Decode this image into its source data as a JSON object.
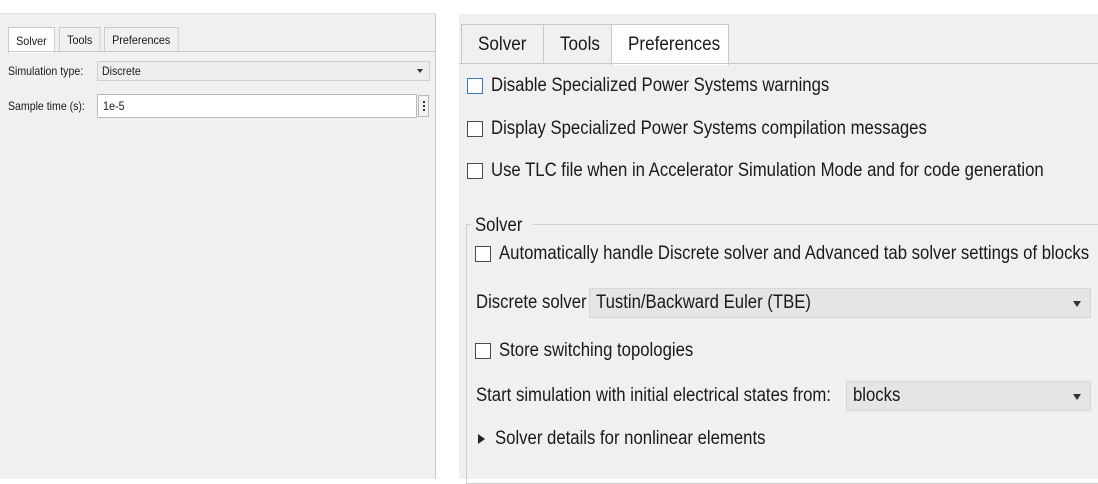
{
  "left_panel": {
    "tabs": [
      "Solver",
      "Tools",
      "Preferences"
    ],
    "active_tab": "Solver",
    "simulation_type": {
      "label": "Simulation type:",
      "value": "Discrete"
    },
    "sample_time": {
      "label": "Sample time (s):",
      "value": "1e-5"
    }
  },
  "right_panel": {
    "tabs": [
      "Solver",
      "Tools",
      "Preferences"
    ],
    "active_tab": "Preferences",
    "checkboxes": {
      "disable_warnings": {
        "label": "Disable Specialized Power Systems warnings",
        "checked": false
      },
      "display_messages": {
        "label": "Display Specialized Power Systems compilation messages",
        "checked": false
      },
      "use_tlc": {
        "label": "Use TLC file when in Accelerator Simulation Mode and for code generation",
        "checked": false
      }
    },
    "solver_group": {
      "title": "Solver",
      "auto_handle": {
        "label": "Automatically handle Discrete solver and Advanced tab solver settings of blocks",
        "checked": false
      },
      "discrete_solver": {
        "label": "Discrete solver",
        "value": "Tustin/Backward Euler (TBE)"
      },
      "store_topologies": {
        "label": "Store switching topologies",
        "checked": false
      },
      "initial_states": {
        "label": "Start simulation with initial electrical states from:",
        "value": "blocks"
      },
      "details": {
        "label": "Solver details for nonlinear elements"
      }
    }
  },
  "colors": {
    "panel_bg": "#f0f0f0",
    "focus_border": "#3a78c9"
  }
}
